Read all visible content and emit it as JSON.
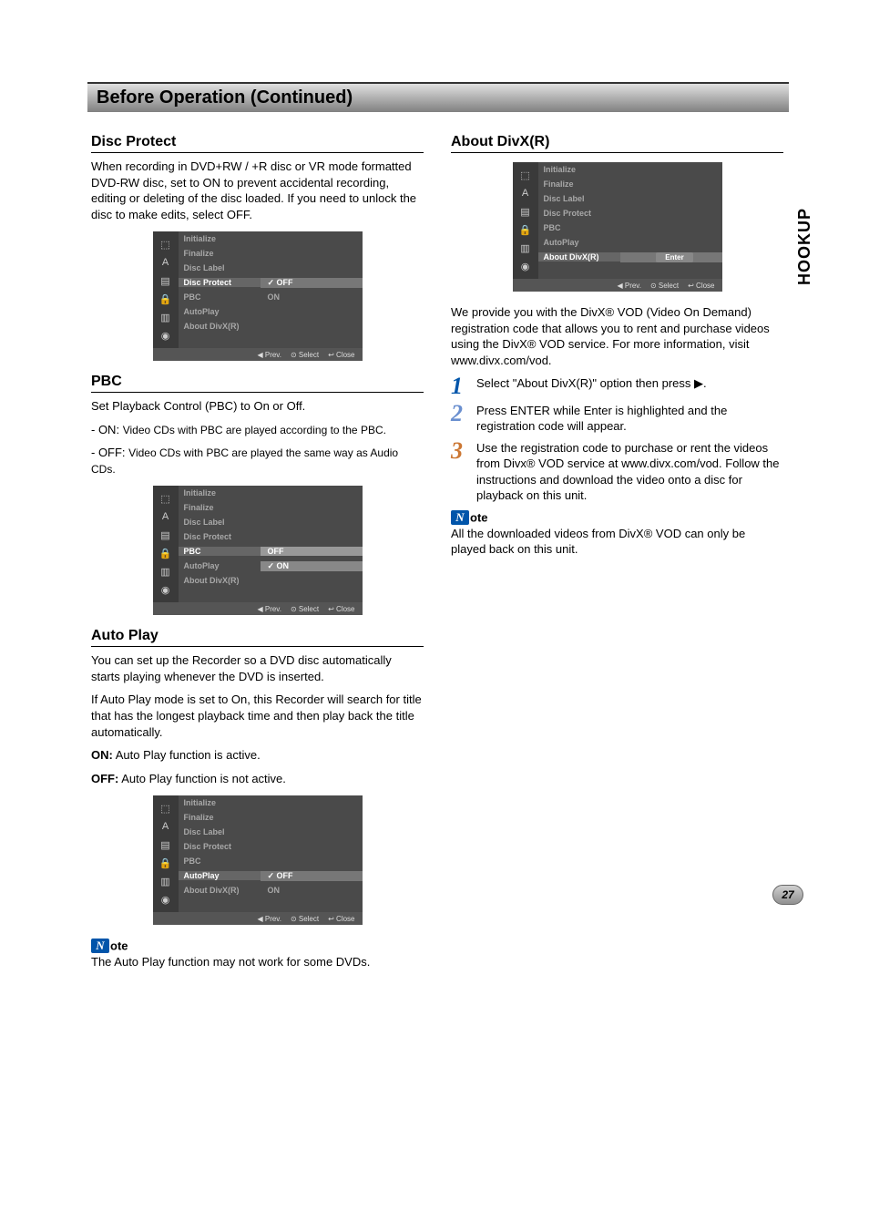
{
  "sideTab": "HOOKUP",
  "pageNumber": "27",
  "sectionTitle": "Before Operation (Continued)",
  "left": {
    "discProtect": {
      "title": "Disc Protect",
      "body": "When recording in DVD+RW / +R disc or VR mode formatted DVD-RW disc, set to ON to prevent accidental recording, editing or deleting of the disc loaded. If you need to unlock the disc to make edits, select OFF."
    },
    "pbc": {
      "title": "PBC",
      "intro": "Set Playback Control (PBC) to On or Off.",
      "onLabel": "- ON:",
      "onText": "Video CDs with PBC are played according to the PBC.",
      "offLabel": "- OFF:",
      "offText": "Video CDs with PBC are played the same way as Audio CDs."
    },
    "autoPlay": {
      "title": "Auto Play",
      "body1": "You can set up the Recorder so a DVD disc automatically starts playing whenever the DVD is inserted.",
      "body2": "If Auto Play mode is set to On, this Recorder will search for title that has the longest playback time and then play back the title automatically.",
      "onLabel": "ON:",
      "onText": "Auto Play function is active.",
      "offLabel": "OFF:",
      "offText": "Auto Play function is not active.",
      "noteLabel": "ote",
      "noteBody": "The Auto Play function may not work for some DVDs."
    }
  },
  "right": {
    "divx": {
      "title": "About DivX(R)",
      "body": "We provide you with the DivX® VOD (Video On Demand) registration code that allows you to rent and purchase videos using the DivX® VOD service. For more information, visit www.divx.com/vod.",
      "step1": "Select \"About DivX(R)\" option then press ▶.",
      "step2": "Press ENTER while Enter is highlighted and the registration code will appear.",
      "step3": "Use the registration code to purchase or rent the videos from Divx® VOD service at www.divx.com/vod. Follow the instructions and download the video onto a disc for playback on this unit.",
      "noteLabel": "ote",
      "noteBody": "All the downloaded videos from DivX® VOD can only be played back on this unit."
    }
  },
  "menuCommon": {
    "items": [
      "Initialize",
      "Finalize",
      "Disc Label",
      "Disc Protect",
      "PBC",
      "AutoPlay",
      "About DivX(R)"
    ],
    "footerPrev": "◀ Prev.",
    "footerSelect": "⊙ Select",
    "footerClose": "↩ Close"
  },
  "menu1": {
    "selected": "Disc Protect",
    "values": {
      "Disc Protect": "OFF",
      "PBC": "ON"
    },
    "checked": "OFF"
  },
  "menu2": {
    "selected": "PBC",
    "values": {
      "PBC": "OFF",
      "AutoPlay": "ON"
    },
    "checked": "ON",
    "hiliteVal": "OFF"
  },
  "menu3": {
    "selected": "AutoPlay",
    "values": {
      "AutoPlay": "OFF",
      "About DivX(R)": "ON"
    },
    "checked": "OFF"
  },
  "menu4": {
    "selected": "About DivX(R)",
    "enterBtn": "Enter"
  }
}
